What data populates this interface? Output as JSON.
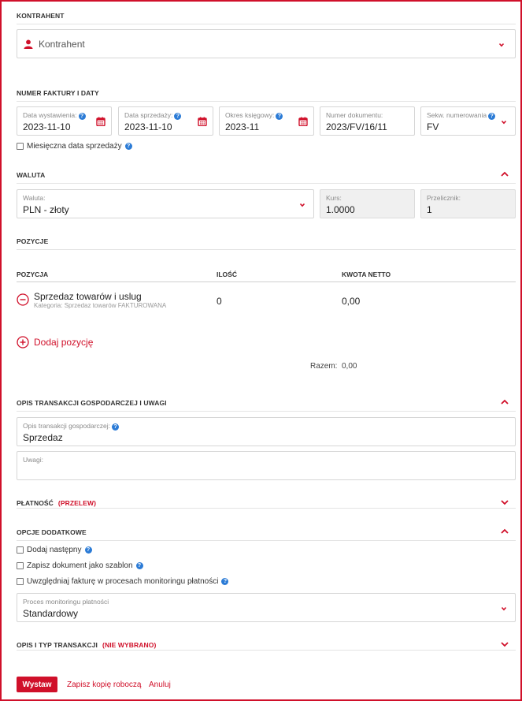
{
  "contractor": {
    "section_title": "KONTRAHENT",
    "placeholder": "Kontrahent"
  },
  "invoice_dates": {
    "section_title": "NUMER FAKTURY I DATY",
    "issue_date": {
      "label": "Data wystawienia:",
      "value": "2023-11-10"
    },
    "sale_date": {
      "label": "Data sprzedaży:",
      "value": "2023-11-10"
    },
    "accounting_period": {
      "label": "Okres księgowy:",
      "value": "2023-11"
    },
    "document_number": {
      "label": "Numer dokumentu:",
      "value": "2023/FV/16/11"
    },
    "numbering_sequence": {
      "label": "Sekw. numerowania",
      "value": "FV"
    },
    "monthly_sale_date_label": "Miesięczna data sprzedaży"
  },
  "currency": {
    "section_title": "WALUTA",
    "currency_field": {
      "label": "Waluta:",
      "value": "PLN - złoty"
    },
    "rate_field": {
      "label": "Kurs:",
      "value": "1.0000"
    },
    "converter_field": {
      "label": "Przelicznik:",
      "value": "1"
    }
  },
  "positions": {
    "section_title": "POZYCJE",
    "columns": [
      "POZYCJA",
      "ILOŚĆ",
      "KWOTA NETTO"
    ],
    "rows": [
      {
        "name": "Sprzedaz towarów i uslug",
        "category": "Kategoria: Sprzedaz towarów FAKTUROWANA",
        "quantity": "0",
        "net_amount": "0,00"
      }
    ],
    "add_label": "Dodaj pozycję",
    "total_label": "Razem:",
    "total_value": "0,00"
  },
  "description": {
    "section_title": "OPIS TRANSAKCJI GOSPODARCZEJ I UWAGI",
    "transaction_field": {
      "label": "Opis transakcji gospodarczej:",
      "value": "Sprzedaz"
    },
    "notes_field": {
      "label": "Uwagi:",
      "value": ""
    }
  },
  "payment": {
    "section_title": "PŁATNOŚĆ",
    "tag": "(PRZELEW)"
  },
  "extra_options": {
    "section_title": "OPCJE DODATKOWE",
    "add_next_label": "Dodaj następny",
    "save_template_label": "Zapisz dokument jako szablon",
    "monitoring_label": "Uwzględniaj fakturę w procesach monitoringu płatności",
    "monitoring_process": {
      "label": "Proces monitoringu płatności",
      "value": "Standardowy"
    }
  },
  "transaction_type": {
    "section_title": "OPIS I TYP TRANSAKCJI",
    "tag": "(NIE WYBRANO)"
  },
  "actions": {
    "issue_label": "Wystaw",
    "save_draft_label": "Zapisz kopię roboczą",
    "cancel_label": "Anuluj"
  },
  "colors": {
    "accent": "#d0102a",
    "help": "#2b7bd6",
    "readonly_bg": "#f0f0f0"
  },
  "icons": [
    "user-icon",
    "chevron-down-icon",
    "chevron-up-icon",
    "calendar-icon",
    "help-icon",
    "minus-circle-icon",
    "plus-circle-icon"
  ]
}
